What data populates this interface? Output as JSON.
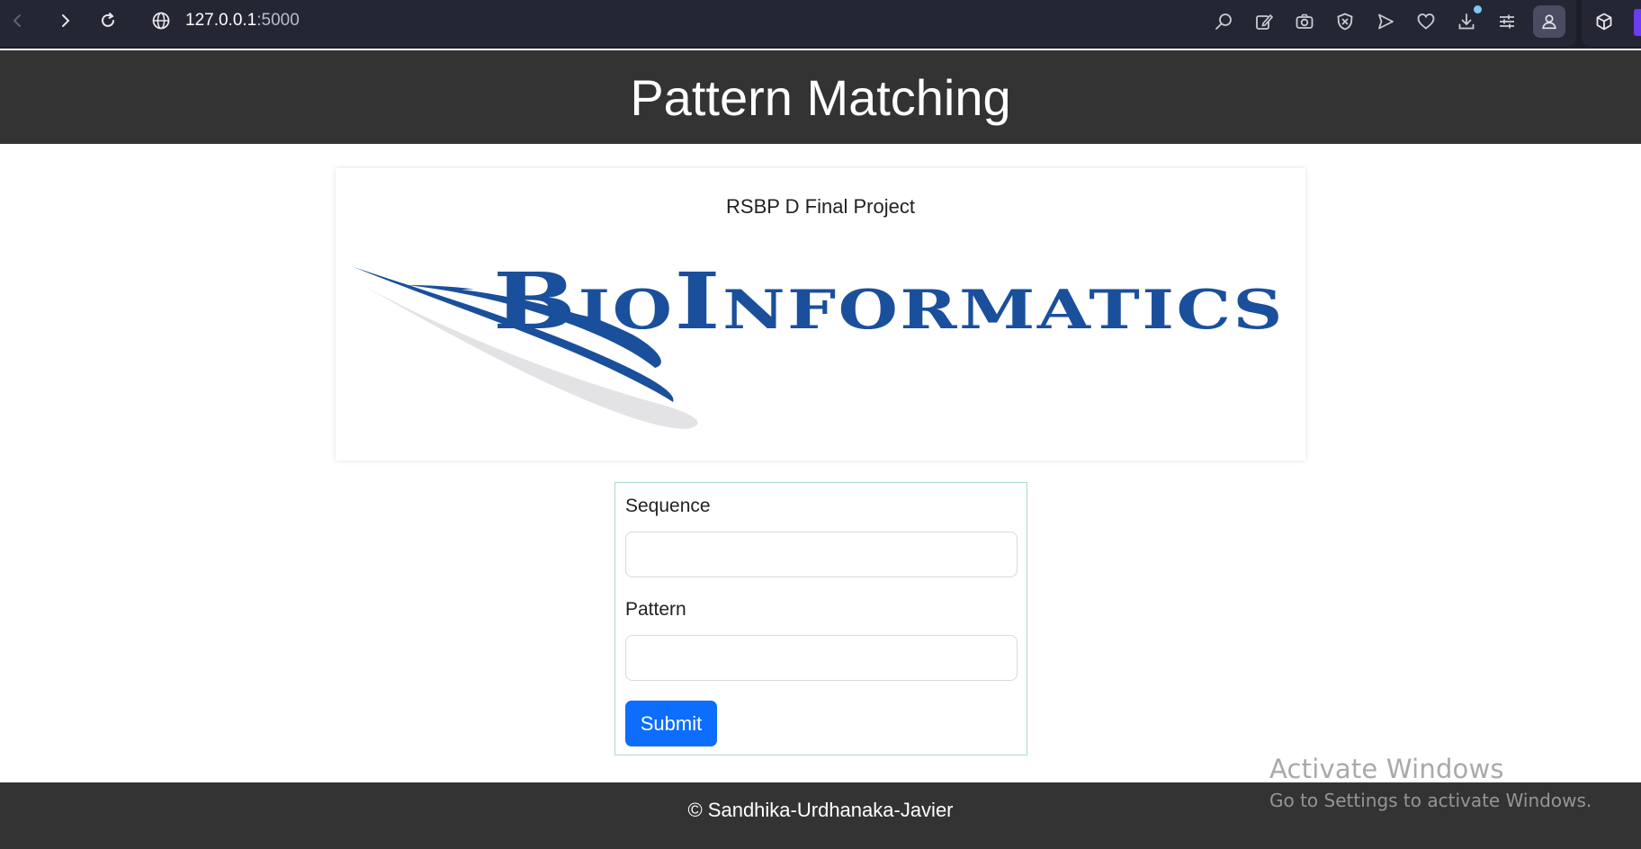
{
  "browser": {
    "url_host": "127.0.0.1",
    "url_port": ":5000",
    "icons": [
      "back-icon",
      "forward-icon",
      "reload-icon",
      "globe-icon",
      "zoom-icon",
      "edit-icon",
      "camera-icon",
      "shield-icon",
      "send-icon",
      "heart-icon",
      "download-icon",
      "settings-icon",
      "profile-icon",
      "cube-icon"
    ]
  },
  "header": {
    "title": "Pattern Matching"
  },
  "card": {
    "subtitle": "RSBP D Final Project",
    "logo_text": "BioInformatics"
  },
  "form": {
    "sequence_label": "Sequence",
    "sequence_value": "",
    "pattern_label": "Pattern",
    "pattern_value": "",
    "submit_label": "Submit"
  },
  "footer": {
    "text": "© Sandhika-Urdhanaka-Javier"
  },
  "watermark": {
    "title": "Activate Windows",
    "subtitle": "Go to Settings to activate Windows."
  },
  "colors": {
    "header_bg": "#333333",
    "primary": "#0d6efd",
    "logo_blue": "#1a4f9c"
  }
}
